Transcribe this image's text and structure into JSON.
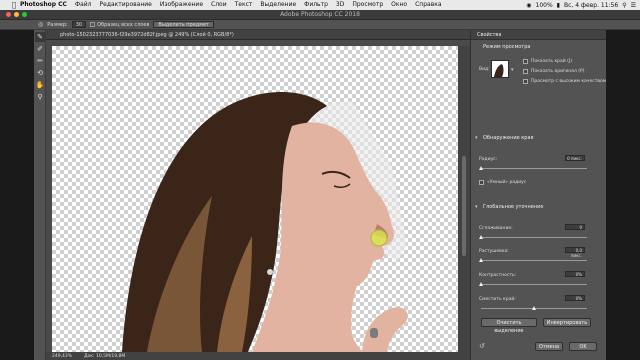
{
  "menubar": {
    "app": "Photoshop CC",
    "items": [
      "Файл",
      "Редактирование",
      "Изображение",
      "Слои",
      "Текст",
      "Выделение",
      "Фильтр",
      "3D",
      "Просмотр",
      "Окно",
      "Справка"
    ],
    "clock": "Вс, 4 февр.  11:56",
    "battery": "100%"
  },
  "window": {
    "title": "Adobe Photoshop CC 2018"
  },
  "options_bar": {
    "size_label": "Размер:",
    "size_value": "30",
    "sample_all_layers": "Образец всех слоев",
    "refine_edge_button": "Выделить предмет"
  },
  "document": {
    "tab_title": "photo-1502323777036-f29e3972d82f.jpeg @ 249% (Слой 0, RGB/8*)",
    "zoom": "249,43%",
    "doc_info": "Док: 10,5M/19,8M"
  },
  "panel": {
    "tab": "Свойства",
    "view_mode_title": "Режим просмотра",
    "view_label": "Вид:",
    "show_edge": "Показать край (J)",
    "show_original": "Показать оригинал (P)",
    "high_quality": "Просмотр с высоким качеством",
    "edge_detection_title": "Обнаружение края",
    "radius_label": "Радиус:",
    "radius_value": "0 пикс.",
    "smart_radius": "«Умный» радиус",
    "global_title": "Глобальное уточнение",
    "smooth_label": "Сглаживание:",
    "smooth_value": "0",
    "feather_label": "Растушевка:",
    "feather_value": "0,0 пикс.",
    "contrast_label": "Контрастность:",
    "contrast_value": "0%",
    "shift_label": "Сместить край:",
    "shift_value": "0%",
    "clear_selection": "Очистить выделение",
    "invert": "Инвертировать",
    "cancel": "Отмена",
    "ok": "OK"
  },
  "colors": {
    "accent_green": "#d8e84a"
  }
}
